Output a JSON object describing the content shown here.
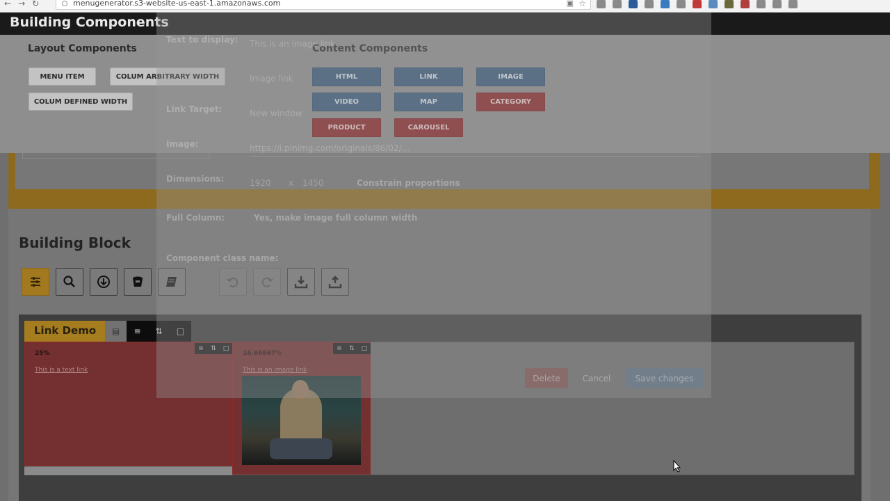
{
  "browser": {
    "url": "menugenerator.s3-website-us-east-1.amazonaws.com"
  },
  "page": {
    "title": "Building Components"
  },
  "layout_components": {
    "heading": "Layout Components",
    "buttons": [
      "MENU ITEM",
      "COLUM ARBITRARY WIDTH",
      "COLUM DEFINED WIDTH"
    ]
  },
  "content_components": {
    "heading": "Content Components",
    "buttons": [
      {
        "label": "HTML",
        "color": "#375a7a"
      },
      {
        "label": "LINK",
        "color": "#375a7a"
      },
      {
        "label": "IMAGE",
        "color": "#375a7a"
      },
      {
        "label": "VIDEO",
        "color": "#375a7a"
      },
      {
        "label": "MAP",
        "color": "#375a7a"
      },
      {
        "label": "CATEGORY",
        "color": "#8c2224"
      },
      {
        "label": "PRODUCT",
        "color": "#8c2224"
      },
      {
        "label": "CAROUSEL",
        "color": "#8c2224"
      }
    ]
  },
  "building_block": {
    "heading": "Building Block",
    "tools": [
      "settings-sliders-icon",
      "search-icon",
      "download-circle-icon",
      "bucket-icon",
      "book-icon",
      "undo-icon",
      "redo-icon",
      "import-icon",
      "export-icon"
    ]
  },
  "demo": {
    "tab_label": "Link Demo",
    "columns": [
      {
        "width_label": "25%",
        "link_text": "This is a text link"
      },
      {
        "width_label": "16.66667%",
        "link_text": "This is an image link"
      }
    ]
  },
  "modal": {
    "fields": [
      {
        "label": "Text to display:",
        "value": "This is an image link"
      },
      {
        "label": "",
        "value": "Image link"
      },
      {
        "label": "Link Target:",
        "value": "New window"
      },
      {
        "label": "Image:",
        "value": "https://i.pinimg.com/originals/86/02/..."
      },
      {
        "label": "Dimensions:",
        "value": "1920"
      },
      {
        "label": "Full Column:",
        "value": "Yes, make image full column width"
      },
      {
        "label": "Component class name:",
        "value": ""
      }
    ],
    "dimension_height": "1450",
    "constrain_label": "Constrain proportions",
    "buttons": [
      "Delete",
      "Cancel",
      "Save changes"
    ]
  },
  "colors": {
    "accent_gold": "#a57d1e",
    "category_red": "#8c2224",
    "content_blue": "#375a7a"
  }
}
